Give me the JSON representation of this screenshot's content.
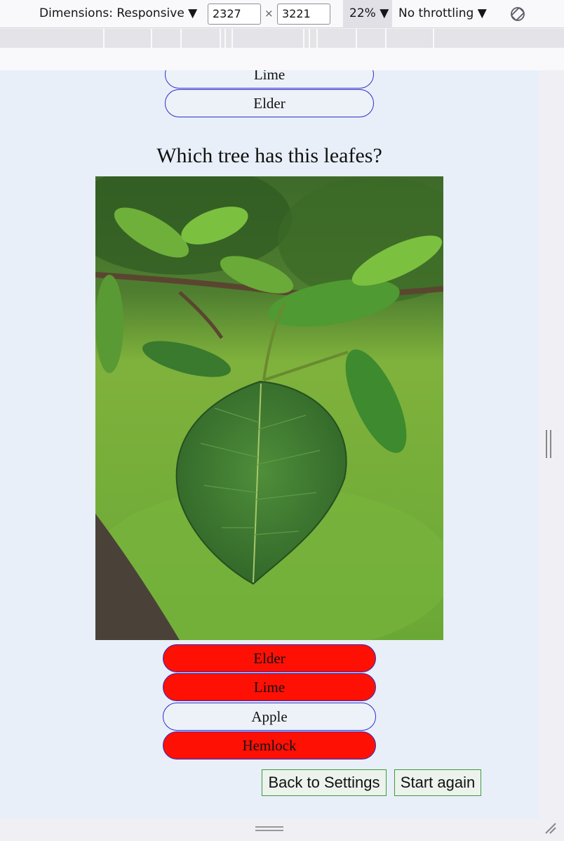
{
  "devtools": {
    "dimensions_label": "Dimensions: Responsive ▼",
    "width_value": "2327",
    "times_symbol": "×",
    "height_value": "3221",
    "zoom_label": "22% ▼",
    "throttling_label": "No throttling ▼",
    "rotate_icon": "rotate-icon"
  },
  "quiz": {
    "previous_options": [
      {
        "label": "Lime"
      },
      {
        "label": "Elder"
      }
    ],
    "question": "Which tree has this leafes?",
    "image_icon": "apple-leaf-photo",
    "options": [
      {
        "label": "Elder",
        "state": "wrong"
      },
      {
        "label": "Lime",
        "state": "wrong"
      },
      {
        "label": "Apple",
        "state": "neutral"
      },
      {
        "label": "Hemlock",
        "state": "wrong"
      }
    ],
    "back_button": "Back to Settings",
    "restart_button": "Start again"
  },
  "colors": {
    "wrong": "#fe1005",
    "option_border": "#2e2ec8",
    "viewport_bg": "#e8eff8",
    "button_border": "#3c9c3c"
  }
}
